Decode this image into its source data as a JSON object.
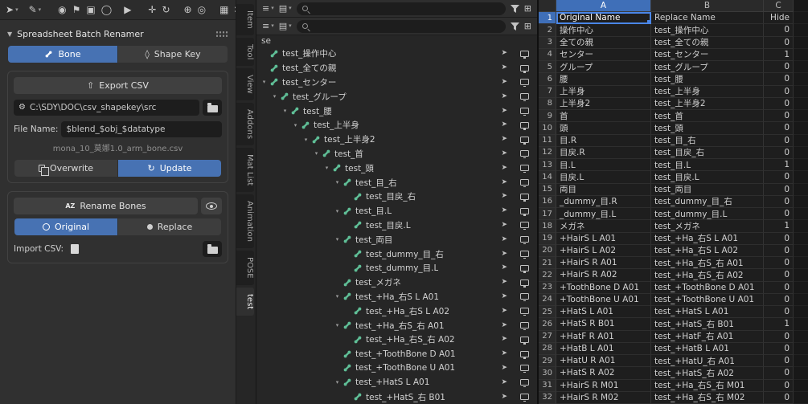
{
  "accent_colors": {
    "blue": "#4772b3",
    "bone_green": "#5fbe96",
    "header_blue": "#3f6fb8",
    "selection_border": "#4a86e8"
  },
  "icons": {
    "panel_caret": "▼",
    "sort_az": "AZ",
    "refresh": "↻",
    "export_arrow": "⇧",
    "wrench": "⚙",
    "menu": "≡",
    "image": "▤",
    "caret_small": "▾",
    "new_collection": "⊞",
    "cursor_arrow": "➤",
    "shape_key": "◊"
  },
  "viewport_header": {
    "tools": [
      {
        "name": "tweak-select-tool-button",
        "glyph": "➤",
        "dropdown": true
      },
      {
        "name": "annotate-tool-button",
        "glyph": "✎",
        "dropdown": true,
        "gap": 6
      },
      {
        "name": "pose-mode-button",
        "glyph": "◉",
        "gap": 14
      },
      {
        "name": "flag-marker-button",
        "glyph": "⚑"
      },
      {
        "name": "mirror-toggle-button",
        "glyph": "▣"
      },
      {
        "name": "sphere-widget-button",
        "glyph": "◯"
      },
      {
        "name": "play-button",
        "glyph": "▶",
        "gap": 8
      },
      {
        "name": "transform-gizmo-button",
        "glyph": "✛",
        "gap": 14
      },
      {
        "name": "rotate-gizmo-button",
        "glyph": "↻"
      },
      {
        "name": "snapping-button",
        "glyph": "⊕",
        "gap": 10
      },
      {
        "name": "proportional-edit-button",
        "glyph": "◎"
      },
      {
        "name": "overlays-button",
        "glyph": "▦",
        "gap": 10
      },
      {
        "name": "editor-display-button",
        "glyph": "∷",
        "dropdown": true
      }
    ]
  },
  "sidebar": {
    "panel_title": "Spreadsheet Batch Renamer",
    "mode_tabs": {
      "bone": "Bone",
      "shape_key": "Shape Key"
    },
    "export_button": "Export CSV",
    "csv_dir": "C:\\SDY\\DOC\\csv_shapekey\\src",
    "file_name_label": "File Name:",
    "file_name_value": "$blend_$obj_$datatype",
    "file_name_preview": "mona_10_莫娜1.0_arm_bone.csv",
    "overwrite_button": "Overwrite",
    "update_button": "Update",
    "rename_button": "Rename Bones",
    "name_mode": {
      "original": "Original",
      "replace": "Replace"
    },
    "import_label": "Import CSV:"
  },
  "side_tabs": [
    {
      "label": "Item"
    },
    {
      "label": "Tool"
    },
    {
      "label": "View"
    },
    {
      "label": "Addons"
    },
    {
      "label": "Mat List"
    },
    {
      "label": "Animation"
    },
    {
      "label": "POSE"
    },
    {
      "label": "test",
      "active": true
    }
  ],
  "outliner": {
    "clipped_row_label": "se",
    "search_value": "",
    "rows": [
      {
        "label": "test_操作中心",
        "indent": 0,
        "arrow": false
      },
      {
        "label": "test_全ての親",
        "indent": 0,
        "arrow": false
      },
      {
        "label": "test_センター",
        "indent": 0,
        "arrow": true
      },
      {
        "label": "test_グループ",
        "indent": 1,
        "arrow": true
      },
      {
        "label": "test_腰",
        "indent": 2,
        "arrow": true
      },
      {
        "label": "test_上半身",
        "indent": 3,
        "arrow": true
      },
      {
        "label": "test_上半身2",
        "indent": 4,
        "arrow": true
      },
      {
        "label": "test_首",
        "indent": 5,
        "arrow": true
      },
      {
        "label": "test_頭",
        "indent": 6,
        "arrow": true
      },
      {
        "label": "test_目_右",
        "indent": 7,
        "arrow": true
      },
      {
        "label": "test_目戻_右",
        "indent": 8,
        "arrow": false
      },
      {
        "label": "test_目.L",
        "indent": 7,
        "arrow": true
      },
      {
        "label": "test_目戻.L",
        "indent": 8,
        "arrow": false
      },
      {
        "label": "test_両目",
        "indent": 7,
        "arrow": true
      },
      {
        "label": "test_dummy_目_右",
        "indent": 8,
        "arrow": false
      },
      {
        "label": "test_dummy_目.L",
        "indent": 8,
        "arrow": false
      },
      {
        "label": "test_メガネ",
        "indent": 7,
        "arrow": false
      },
      {
        "label": "test_+Ha_右S L A01",
        "indent": 7,
        "arrow": true
      },
      {
        "label": "test_+Ha_右S L A02",
        "indent": 8,
        "arrow": false
      },
      {
        "label": "test_+Ha_右S_右 A01",
        "indent": 7,
        "arrow": true
      },
      {
        "label": "test_+Ha_右S_右 A02",
        "indent": 8,
        "arrow": false
      },
      {
        "label": "test_+ToothBone D A01",
        "indent": 7,
        "arrow": false
      },
      {
        "label": "test_+ToothBone U A01",
        "indent": 7,
        "arrow": false
      },
      {
        "label": "test_+HatS L A01",
        "indent": 7,
        "arrow": true
      },
      {
        "label": "test_+HatS_右 B01",
        "indent": 8,
        "arrow": false
      }
    ]
  },
  "spreadsheet": {
    "columns": [
      {
        "label": "A",
        "selected": true
      },
      {
        "label": "B",
        "selected": false
      },
      {
        "label": "C",
        "selected": false
      }
    ],
    "selected_cell": "A1",
    "rows": [
      {
        "n": 1,
        "a": "Original Name",
        "b": "Replace Name",
        "c": "Hide",
        "selected": true
      },
      {
        "n": 2,
        "a": "操作中心",
        "b": "test_操作中心",
        "c": "0"
      },
      {
        "n": 3,
        "a": "全ての親",
        "b": "test_全ての親",
        "c": "0"
      },
      {
        "n": 4,
        "a": "センター",
        "b": "test_センター",
        "c": "1"
      },
      {
        "n": 5,
        "a": "グループ",
        "b": "test_グループ",
        "c": "0"
      },
      {
        "n": 6,
        "a": "腰",
        "b": "test_腰",
        "c": "0"
      },
      {
        "n": 7,
        "a": "上半身",
        "b": "test_上半身",
        "c": "0"
      },
      {
        "n": 8,
        "a": "上半身2",
        "b": "test_上半身2",
        "c": "0"
      },
      {
        "n": 9,
        "a": "首",
        "b": "test_首",
        "c": "0"
      },
      {
        "n": 10,
        "a": "頭",
        "b": "test_頭",
        "c": "0"
      },
      {
        "n": 11,
        "a": "目.R",
        "b": "test_目_右",
        "c": "0"
      },
      {
        "n": 12,
        "a": "目戻.R",
        "b": "test_目戻_右",
        "c": "0"
      },
      {
        "n": 13,
        "a": "目.L",
        "b": "test_目.L",
        "c": "1"
      },
      {
        "n": 14,
        "a": "目戻.L",
        "b": "test_目戻.L",
        "c": "0"
      },
      {
        "n": 15,
        "a": "両目",
        "b": "test_両目",
        "c": "0"
      },
      {
        "n": 16,
        "a": "_dummy_目.R",
        "b": "test_dummy_目_右",
        "c": "0"
      },
      {
        "n": 17,
        "a": "_dummy_目.L",
        "b": "test_dummy_目.L",
        "c": "0"
      },
      {
        "n": 18,
        "a": "メガネ",
        "b": "test_メガネ",
        "c": "1"
      },
      {
        "n": 19,
        "a": "+HairS L A01",
        "b": "test_+Ha_右S L A01",
        "c": "0"
      },
      {
        "n": 20,
        "a": "+HairS L A02",
        "b": "test_+Ha_右S L A02",
        "c": "0"
      },
      {
        "n": 21,
        "a": "+HairS R A01",
        "b": "test_+Ha_右S_右 A01",
        "c": "0"
      },
      {
        "n": 22,
        "a": "+HairS R A02",
        "b": "test_+Ha_右S_右 A02",
        "c": "0"
      },
      {
        "n": 23,
        "a": "+ToothBone D A01",
        "b": "test_+ToothBone D A01",
        "c": "0"
      },
      {
        "n": 24,
        "a": "+ToothBone U A01",
        "b": "test_+ToothBone U A01",
        "c": "0"
      },
      {
        "n": 25,
        "a": "+HatS L A01",
        "b": "test_+HatS L A01",
        "c": "0"
      },
      {
        "n": 26,
        "a": "+HatS R B01",
        "b": "test_+HatS_右 B01",
        "c": "1"
      },
      {
        "n": 27,
        "a": "+HatF R A01",
        "b": "test_+HatF_右 A01",
        "c": "0"
      },
      {
        "n": 28,
        "a": "+HatB L A01",
        "b": "test_+HatB L A01",
        "c": "0"
      },
      {
        "n": 29,
        "a": "+HatU R A01",
        "b": "test_+HatU_右 A01",
        "c": "0"
      },
      {
        "n": 30,
        "a": "+HatS R A02",
        "b": "test_+HatS_右 A02",
        "c": "0"
      },
      {
        "n": 31,
        "a": "+HairS R M01",
        "b": "test_+Ha_右S_右 M01",
        "c": "0"
      },
      {
        "n": 32,
        "a": "+HairS R M02",
        "b": "test_+Ha_右S_右 M02",
        "c": "0"
      }
    ]
  }
}
